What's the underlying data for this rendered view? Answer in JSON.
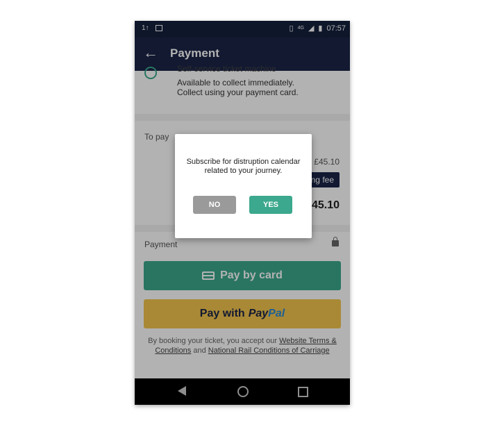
{
  "statusbar": {
    "left_indicator": "1↑",
    "network": "4G",
    "time": "07:57"
  },
  "appbar": {
    "title": "Payment"
  },
  "collection": {
    "option_clipped": "Self-service ticket machine",
    "info_line1": "Available to collect immediately.",
    "info_line2": "Collect using your payment card."
  },
  "summary": {
    "to_pay_label": "To pay",
    "price": "£45.10",
    "fee_badge": "ing fee",
    "total": "45.10"
  },
  "payment": {
    "label": "Payment",
    "pay_card_label": "Pay by card",
    "paypal_prefix": "Pay with",
    "paypal_brand_1": "Pay",
    "paypal_brand_2": "Pal",
    "legal_1": "By booking your ticket, you accept our",
    "legal_link_1": "Website Terms & Conditions",
    "legal_and": "and",
    "legal_link_2": "National Rail Conditions of Carriage"
  },
  "dialog": {
    "message": "Subscribe for distruption calendar related to your journey.",
    "no_label": "NO",
    "yes_label": "YES"
  },
  "colors": {
    "appbar": "#1b2447",
    "accent": "#3ca88d",
    "paypal": "#f3c54e"
  }
}
